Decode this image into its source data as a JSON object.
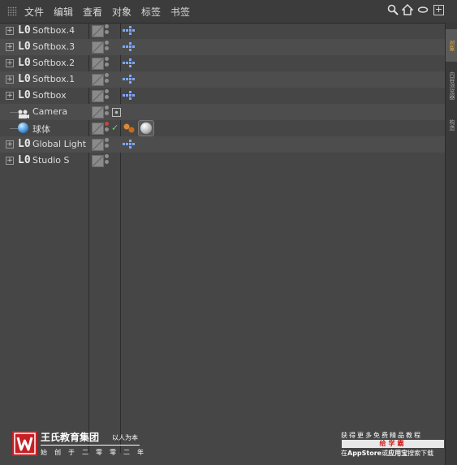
{
  "menu": {
    "items": [
      "文件",
      "编辑",
      "查看",
      "对象",
      "标签",
      "书签"
    ]
  },
  "objects": [
    {
      "label": "Softbox.4",
      "icon": "null-icon",
      "tag": "light"
    },
    {
      "label": "Softbox.3",
      "icon": "null-icon",
      "tag": "light"
    },
    {
      "label": "Softbox.2",
      "icon": "null-icon",
      "tag": "light"
    },
    {
      "label": "Softbox.1",
      "icon": "null-icon",
      "tag": "light"
    },
    {
      "label": "Softbox",
      "icon": "null-icon",
      "tag": "light"
    },
    {
      "label": "Camera",
      "icon": "camera-icon",
      "tag": "target"
    },
    {
      "label": "球体",
      "icon": "sphere-icon",
      "tag": "material"
    },
    {
      "label": "Global Light",
      "icon": "null-icon",
      "tag": "light"
    },
    {
      "label": "Studio S",
      "icon": "null-icon",
      "tag": "none"
    }
  ],
  "side_tabs": [
    "对象",
    "内容浏览器",
    "构造"
  ],
  "branding": {
    "name": "王氏教育集团",
    "slogan": "以人为本",
    "sub": "始创于二零零二年",
    "promo_top": "获得更多免费精品教程",
    "promo_bar": "给学霸",
    "promo_bottom_1": "在",
    "promo_bottom_2": "AppStore",
    "promo_bottom_3": "或",
    "promo_bottom_4": "应用宝",
    "promo_bottom_5": "搜索下载"
  },
  "colors": {
    "background": "#464646",
    "menubar": "#3c3c3c",
    "logo_red": "#c62024",
    "tag_blue": "#7fa6ff",
    "check_green": "#6fd26f",
    "active_tab": "#e0b040"
  }
}
